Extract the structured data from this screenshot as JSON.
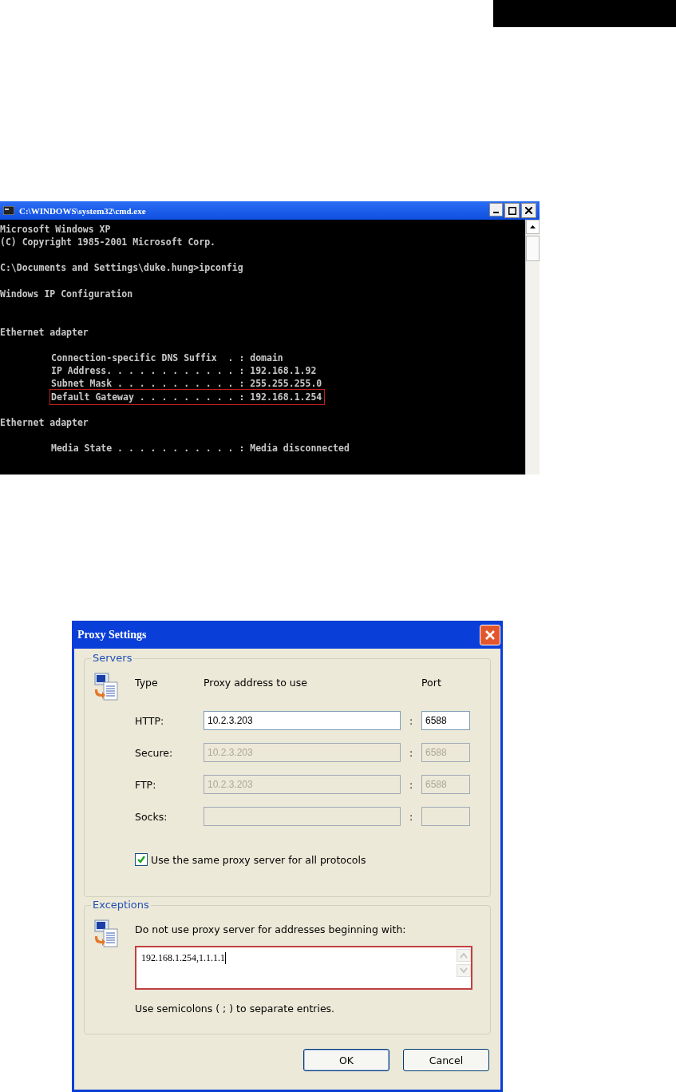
{
  "console_window": {
    "title": "C:\\WINDOWS\\system32\\cmd.exe",
    "blocks": [
      {
        "lines": [
          {
            "text": "Microsoft Windows XP",
            "indented": false,
            "highlighted": false
          },
          {
            "text": "(C) Copyright 1985-2001 Microsoft Corp.",
            "indented": false,
            "highlighted": false
          }
        ]
      },
      {
        "lines": [
          {
            "text": "C:\\Documents and Settings\\duke.hung>ipconfig",
            "indented": false,
            "highlighted": false
          }
        ]
      },
      {
        "lines": [
          {
            "text": "Windows IP Configuration",
            "indented": false,
            "highlighted": false
          }
        ]
      },
      {
        "lines": [
          {
            "text": "Ethernet adapter",
            "indented": false,
            "highlighted": false
          }
        ]
      },
      {
        "lines": [
          {
            "text": "Connection-specific DNS Suffix  . : domain",
            "indented": true,
            "highlighted": false
          },
          {
            "text": "IP Address. . . . . . . . . . . . : 192.168.1.92",
            "indented": true,
            "highlighted": false
          },
          {
            "text": "Subnet Mask . . . . . . . . . . . : 255.255.255.0",
            "indented": true,
            "highlighted": false
          },
          {
            "text": "Default Gateway . . . . . . . . . : 192.168.1.254",
            "indented": true,
            "highlighted": true
          }
        ]
      },
      {
        "lines": [
          {
            "text": "Ethernet adapter",
            "indented": false,
            "highlighted": false
          }
        ]
      },
      {
        "lines": [
          {
            "text": "Media State . . . . . . . . . . . : Media disconnected",
            "indented": true,
            "highlighted": false
          }
        ]
      }
    ]
  },
  "proxy_dialog": {
    "title": "Proxy Settings",
    "servers": {
      "legend": "Servers",
      "headers": {
        "type": "Type",
        "address": "Proxy address to use",
        "port": "Port"
      },
      "rows": [
        {
          "label": "HTTP:",
          "address": "10.2.3.203",
          "port": "6588",
          "disabled": false
        },
        {
          "label": "Secure:",
          "address": "10.2.3.203",
          "port": "6588",
          "disabled": true
        },
        {
          "label": "FTP:",
          "address": "10.2.3.203",
          "port": "6588",
          "disabled": true
        },
        {
          "label": "Socks:",
          "disabled": true
        }
      ],
      "separator": ":",
      "same_proxy": {
        "label": "Use the same proxy server for all protocols",
        "checked": true
      }
    },
    "exceptions": {
      "legend": "Exceptions",
      "prompt": "Do not use proxy server for addresses beginning with:",
      "value": "192.168.1.254,1.1.1.1",
      "highlighted": true,
      "hint": "Use semicolons ( ; ) to separate entries."
    },
    "buttons": [
      "OK",
      "Cancel"
    ]
  }
}
